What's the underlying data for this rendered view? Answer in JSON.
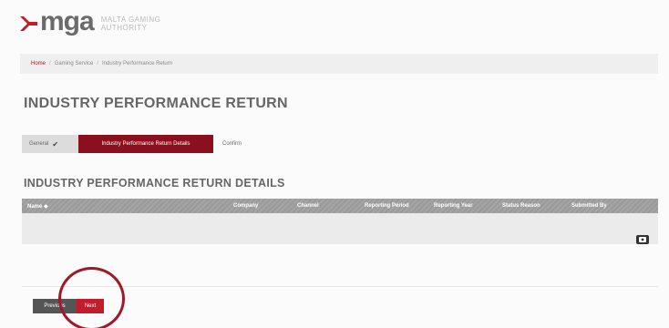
{
  "brand": {
    "word": "mga",
    "subtitle_line1": "Malta Gaming",
    "subtitle_line2": "Authority",
    "accent_color": "#a11b2a"
  },
  "breadcrumb": {
    "home": "Home",
    "separator": "/",
    "item1": "Gaming Service",
    "item2": "Industry Performance Return"
  },
  "page_title": "INDUSTRY PERFORMANCE RETURN",
  "steps": {
    "general": "General",
    "general_icon": "check-icon",
    "details": "Industry Performance Return Details",
    "confirm": "Confirm"
  },
  "section_title": "INDUSTRY PERFORMANCE RETURN DETAILS",
  "grid": {
    "columns": [
      "Name ◆",
      "Company",
      "Channel",
      "Reporting Period",
      "Reporting Year",
      "Status Reason",
      "Submitted By"
    ],
    "rows": [],
    "action_icon": "action-menu-icon"
  },
  "buttons": {
    "previous": "Previous",
    "next": "Next"
  }
}
